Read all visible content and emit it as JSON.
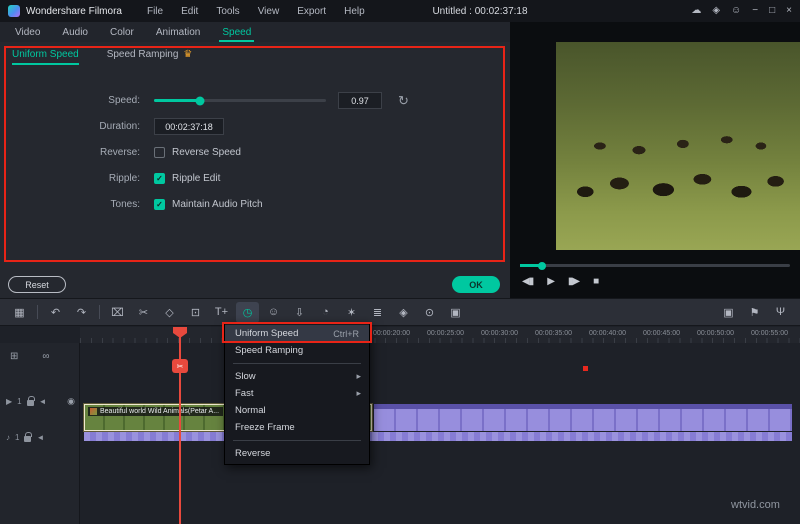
{
  "titlebar": {
    "app_name": "Wondershare Filmora",
    "menus": [
      "File",
      "Edit",
      "Tools",
      "View",
      "Export",
      "Help"
    ],
    "project_title": "Untitled : 00:02:37:18",
    "window_icons": [
      {
        "name": "cloud-icon",
        "glyph": "☁"
      },
      {
        "name": "upgrade-icon",
        "glyph": "◈"
      },
      {
        "name": "account-icon",
        "glyph": "☺"
      },
      {
        "name": "minimize-icon",
        "glyph": "−"
      },
      {
        "name": "maximize-icon",
        "glyph": "□"
      },
      {
        "name": "close-icon",
        "glyph": "×"
      }
    ]
  },
  "tabs": [
    {
      "label": "Video"
    },
    {
      "label": "Audio"
    },
    {
      "label": "Color"
    },
    {
      "label": "Animation"
    },
    {
      "label": "Speed",
      "active": true
    }
  ],
  "speed_panel": {
    "tabs": [
      {
        "label": "Uniform Speed",
        "active": true
      },
      {
        "label": "Speed Ramping",
        "crown": true
      }
    ],
    "speed": {
      "label": "Speed:",
      "value": "0.97",
      "percent": 27
    },
    "duration": {
      "label": "Duration:",
      "value": "00:02:37:18"
    },
    "reverse": {
      "label": "Reverse:",
      "option": "Reverse Speed",
      "checked": false
    },
    "ripple": {
      "label": "Ripple:",
      "option": "Ripple Edit",
      "checked": true
    },
    "tones": {
      "label": "Tones:",
      "option": "Maintain Audio Pitch",
      "checked": true
    },
    "reset_label": "Reset",
    "ok_label": "OK"
  },
  "preview": {
    "progress_percent": 8,
    "controls": [
      {
        "name": "prev-frame-icon",
        "glyph": "◀▮"
      },
      {
        "name": "play-icon",
        "glyph": "▶"
      },
      {
        "name": "next-frame-icon",
        "glyph": "▮▶"
      },
      {
        "name": "stop-icon",
        "glyph": "■"
      }
    ]
  },
  "toolbar": {
    "items": [
      {
        "name": "media-grid-icon",
        "glyph": "▦"
      },
      {
        "divider": true
      },
      {
        "name": "undo-icon",
        "glyph": "↶"
      },
      {
        "name": "redo-icon",
        "glyph": "↷"
      },
      {
        "divider": true
      },
      {
        "name": "delete-icon",
        "glyph": "⌧"
      },
      {
        "name": "split-icon",
        "glyph": "✂"
      },
      {
        "name": "tag-icon",
        "glyph": "◇"
      },
      {
        "name": "crop-icon",
        "glyph": "⊡"
      },
      {
        "name": "text-icon",
        "glyph": "T+"
      },
      {
        "name": "speed-icon",
        "glyph": "◷",
        "active": true
      },
      {
        "name": "mask-icon",
        "glyph": "☺"
      },
      {
        "name": "export-frame-icon",
        "glyph": "⇩"
      },
      {
        "name": "chroma-key-icon",
        "glyph": "◔"
      },
      {
        "name": "effects-icon",
        "glyph": "✶"
      },
      {
        "name": "adjust-icon",
        "glyph": "≣"
      },
      {
        "name": "keyframe-icon",
        "glyph": "◈"
      },
      {
        "name": "motion-track-icon",
        "glyph": "⊙"
      },
      {
        "name": "stabilize-icon",
        "glyph": "▣"
      }
    ],
    "right_items": [
      {
        "name": "snapshot-icon",
        "glyph": "▣"
      },
      {
        "name": "marker-icon",
        "glyph": "⚑"
      },
      {
        "name": "voiceover-icon",
        "glyph": "Ψ"
      }
    ]
  },
  "context_menu": {
    "items": [
      {
        "label": "Uniform Speed",
        "shortcut": "Ctrl+R",
        "highlighted": true
      },
      {
        "label": "Speed Ramping",
        "divider_after": true
      },
      {
        "label": "Slow",
        "submenu": true
      },
      {
        "label": "Fast",
        "submenu": true
      },
      {
        "label": "Normal"
      },
      {
        "label": "Freeze Frame",
        "divider_after": true
      },
      {
        "label": "Reverse"
      }
    ]
  },
  "timeline": {
    "ruler_labels": [
      "00:00:20:00",
      "00:00:25:00",
      "00:00:30:00",
      "00:00:35:00",
      "00:00:40:00",
      "00:00:45:00",
      "00:00:50:00",
      "00:00:55:00"
    ],
    "tracks": {
      "video_label": "1",
      "audio_label": "1"
    },
    "clip": {
      "name": "Beautiful world Wild Animals(Petar A..."
    }
  },
  "icons": {
    "crown": "♛",
    "refresh": "↻",
    "check": "✓",
    "eye": "◉",
    "speaker": "◄",
    "note": "♪",
    "video_track": "▶",
    "submenu_arrow": "▸",
    "track_grid": "⊞",
    "link": "∞",
    "scissors": "✂"
  },
  "watermark": "wtvid.com",
  "colors": {
    "accent": "#00c8a0",
    "annotation": "#e82417",
    "playhead": "#e8493d",
    "clip_green": "#66833f",
    "clip_purple": "#978edd"
  }
}
